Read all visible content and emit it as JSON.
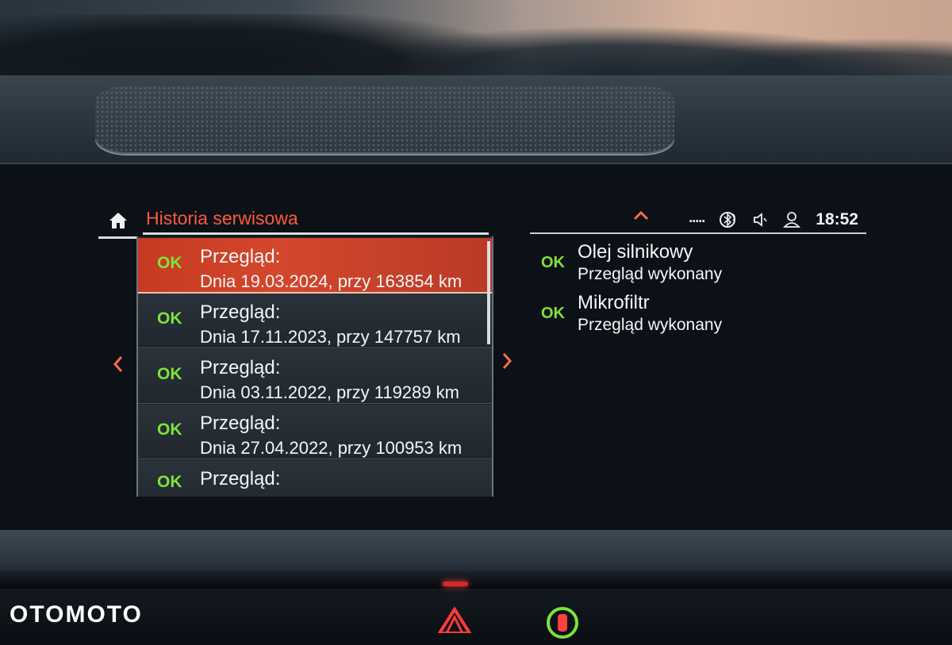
{
  "brand_watermark": "OTOMOTO",
  "header": {
    "title": "Historia serwisowa",
    "home_icon": "home-icon",
    "status_dots": ".....",
    "status_icons": [
      "bluetooth-phone-icon",
      "speaker-icon",
      "user-profile-icon"
    ],
    "clock": "18:52"
  },
  "colors": {
    "accent": "#ff5a3c",
    "selected_row": "#c63a22",
    "ok_green": "#7fe23a",
    "text": "#f4f6f8"
  },
  "service_list": {
    "items": [
      {
        "status": "OK",
        "title": "Przegląd:",
        "detail": "Dnia 19.03.2024, przy 163854 km",
        "selected": true
      },
      {
        "status": "OK",
        "title": "Przegląd:",
        "detail": "Dnia 17.11.2023, przy 147757 km",
        "selected": false
      },
      {
        "status": "OK",
        "title": "Przegląd:",
        "detail": "Dnia 03.11.2022, przy 119289 km",
        "selected": false
      },
      {
        "status": "OK",
        "title": "Przegląd:",
        "detail": "Dnia 27.04.2022, przy 100953 km",
        "selected": false
      },
      {
        "status": "OK",
        "title": "Przegląd:",
        "detail": "",
        "selected": false
      }
    ]
  },
  "detail_panel": {
    "items": [
      {
        "status": "OK",
        "title": "Olej silnikowy",
        "subtitle": "Przegląd wykonany"
      },
      {
        "status": "OK",
        "title": "Mikrofiltr",
        "subtitle": "Przegląd wykonany"
      }
    ]
  }
}
